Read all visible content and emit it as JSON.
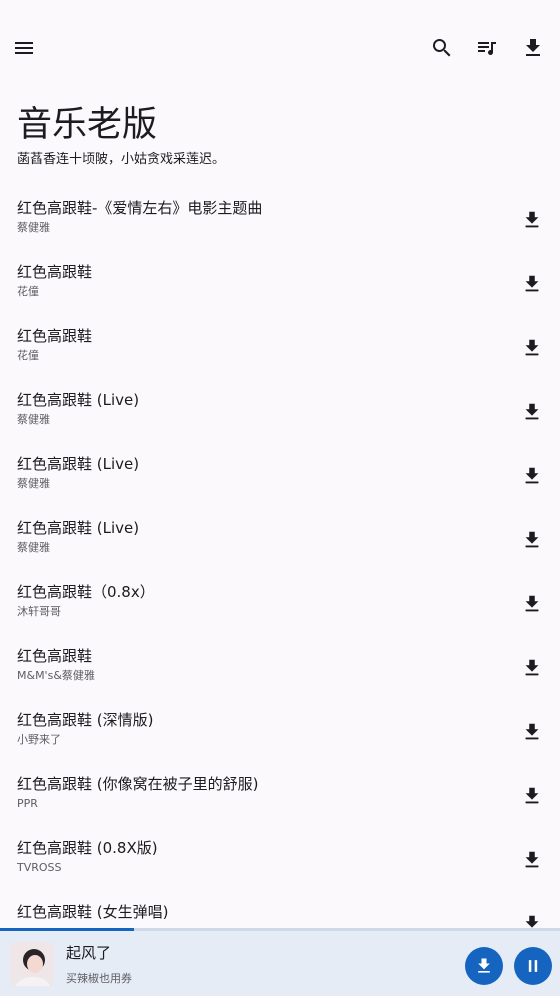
{
  "header": {
    "title": "音乐老版",
    "subtitle": "菡萏香连十顷陂，小姑贪戏采莲迟。"
  },
  "toolbar": {
    "menu_icon": "menu-icon",
    "search_icon": "search-icon",
    "queue_icon": "queue-music-icon",
    "download_icon": "download-icon"
  },
  "songs": [
    {
      "title": "红色高跟鞋-《爱情左右》电影主题曲",
      "artist": "蔡健雅"
    },
    {
      "title": "红色高跟鞋",
      "artist": "花僮"
    },
    {
      "title": "红色高跟鞋",
      "artist": "花僮"
    },
    {
      "title": "红色高跟鞋 (Live)",
      "artist": "蔡健雅"
    },
    {
      "title": "红色高跟鞋 (Live)",
      "artist": "蔡健雅"
    },
    {
      "title": "红色高跟鞋 (Live)",
      "artist": "蔡健雅"
    },
    {
      "title": "红色高跟鞋（0.8x）",
      "artist": "沐轩哥哥"
    },
    {
      "title": "红色高跟鞋",
      "artist": "M&M's&蔡健雅"
    },
    {
      "title": "红色高跟鞋 (深情版)",
      "artist": "小野来了"
    },
    {
      "title": "红色高跟鞋 (你像窝在被子里的舒服)",
      "artist": "PPR"
    },
    {
      "title": "红色高跟鞋 (0.8X版)",
      "artist": "TVROSS"
    },
    {
      "title": "红色高跟鞋 (女生弹唱)",
      "artist": ""
    }
  ],
  "player": {
    "song_title": "起风了",
    "ad_text": "买辣椒也用券",
    "progress": 0.24,
    "accent_color": "#1565c0"
  }
}
